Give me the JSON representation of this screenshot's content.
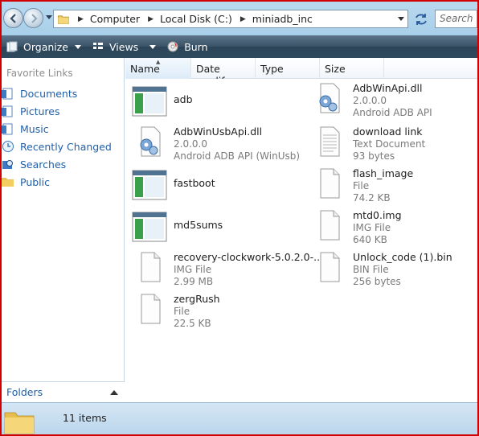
{
  "address": {
    "segments": [
      "Computer",
      "Local Disk (C:)",
      "miniadb_inc"
    ],
    "search_placeholder": "Search"
  },
  "toolbar": {
    "organize_label": "Organize",
    "views_label": "Views",
    "burn_label": "Burn"
  },
  "nav": {
    "favorites_title": "Favorite Links",
    "items": [
      {
        "label": "Documents",
        "icon": "documents-icon"
      },
      {
        "label": "Pictures",
        "icon": "pictures-icon"
      },
      {
        "label": "Music",
        "icon": "music-icon"
      },
      {
        "label": "Recently Changed",
        "icon": "recent-icon"
      },
      {
        "label": "Searches",
        "icon": "searches-icon"
      },
      {
        "label": "Public",
        "icon": "public-folder-icon"
      }
    ],
    "folders_label": "Folders"
  },
  "columns": {
    "name": "Name",
    "date": "Date modif...",
    "type": "Type",
    "size": "Size"
  },
  "files": [
    {
      "name": "adb",
      "icon": "application-icon"
    },
    {
      "name": "AdbWinApi.dll",
      "line2": "2.0.0.0",
      "line3": "Android ADB API",
      "icon": "dll-gear-icon"
    },
    {
      "name": "AdbWinUsbApi.dll",
      "line2": "2.0.0.0",
      "line3": "Android ADB API (WinUsb)",
      "icon": "dll-gear-icon"
    },
    {
      "name": "download link",
      "line2": "Text Document",
      "line3": "93 bytes",
      "icon": "text-document-icon"
    },
    {
      "name": "fastboot",
      "icon": "application-icon"
    },
    {
      "name": "flash_image",
      "line2": "File",
      "line3": "74.2 KB",
      "icon": "blank-file-icon"
    },
    {
      "name": "md5sums",
      "icon": "application-icon"
    },
    {
      "name": "mtd0.img",
      "line2": "IMG File",
      "line3": "640 KB",
      "icon": "blank-file-icon"
    },
    {
      "name": "recovery-clockwork-5.0.2.0-...",
      "line2": "IMG File",
      "line3": "2.99 MB",
      "icon": "blank-file-icon"
    },
    {
      "name": "Unlock_code (1).bin",
      "line2": "BIN File",
      "line3": "256 bytes",
      "icon": "blank-file-icon"
    },
    {
      "name": "zergRush",
      "line2": "File",
      "line3": "22.5 KB",
      "icon": "blank-file-icon"
    }
  ],
  "status": {
    "item_count": "11 items"
  },
  "colors": {
    "frame_border": "#d00000",
    "toolbar_bg": "#3b5266",
    "link_blue": "#1f5fa8",
    "address_bar_bg": "#b9d9ef"
  }
}
